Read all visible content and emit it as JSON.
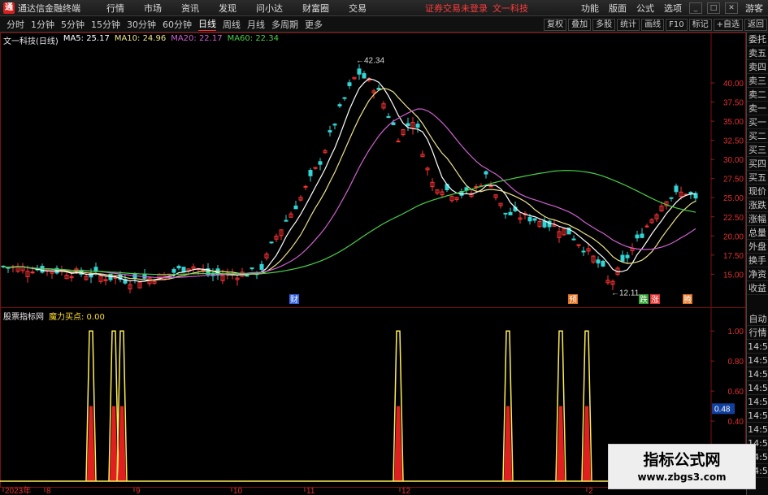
{
  "menubar": {
    "app_title": "通达信金融终端",
    "items": [
      "行情",
      "市场",
      "资讯",
      "发现",
      "问小达",
      "财富圈",
      "交易"
    ],
    "login_warning": "证券交易未登录",
    "stock_name": "文一科技",
    "right_items": [
      "功能",
      "版面",
      "公式",
      "选项"
    ],
    "guest": "游客"
  },
  "toolbar": {
    "periods": [
      "分时",
      "1分钟",
      "5分钟",
      "15分钟",
      "30分钟",
      "60分钟",
      "日线",
      "周线",
      "月线",
      "多周期",
      "更多"
    ],
    "active_period": "日线",
    "right_buttons": [
      "复权",
      "叠加",
      "多股",
      "统计",
      "画线",
      "F10",
      "标记",
      "+自选",
      "返回"
    ]
  },
  "main_panel": {
    "title": "文一科技(日线)",
    "ma5": "MA5: 25.17",
    "ma10": "MA10: 24.96",
    "ma20": "MA20: 22.17",
    "ma60": "MA60: 22.34",
    "high_label": "42.34",
    "low_label": "12.11",
    "markers": [
      "财",
      "预",
      "跌",
      "涨",
      "腾"
    ]
  },
  "sub_panel": {
    "title": "股票指标网",
    "indicator": "魔力买点: 0.00",
    "current_value": "0.48"
  },
  "side_panel": {
    "items": [
      "委托",
      "卖五",
      "卖四",
      "卖三",
      "卖二",
      "卖一",
      "买一",
      "买二",
      "买三",
      "买四",
      "买五",
      "现价",
      "涨跌",
      "涨幅",
      "总量",
      "外盘",
      "换手",
      "净资",
      "收益"
    ],
    "sub_items": [
      "自动",
      "行情",
      "14:5",
      "14:5",
      "14:5",
      "14:5",
      "14:5",
      "14:5",
      "14:5",
      "14:5",
      "14:5",
      "14:5"
    ]
  },
  "x_axis_labels": [
    "2023年",
    "8",
    "9",
    "10",
    "11",
    "12",
    "2"
  ],
  "watermark": {
    "title": "指标公式网",
    "url": "www.zbgs3.com"
  },
  "chart_data": [
    {
      "type": "line",
      "title": "文一科技(日线)",
      "y_ticks": [
        "40.00",
        "37.50",
        "35.00",
        "32.50",
        "30.00",
        "27.50",
        "25.00",
        "22.50",
        "20.00",
        "17.50",
        "15.00"
      ],
      "ylim": [
        11,
        45
      ],
      "series": [
        {
          "name": "MA5",
          "color": "#ffffff"
        },
        {
          "name": "MA10",
          "color": "#f0e38a"
        },
        {
          "name": "MA20",
          "color": "#d060d0"
        },
        {
          "name": "MA60",
          "color": "#48d048"
        }
      ],
      "colors": {
        "up": "#ff3333",
        "down": "#33d6d6"
      }
    },
    {
      "type": "line",
      "title": "魔力买点",
      "y_ticks": [
        "1.00",
        "0.80",
        "0.60",
        "0.40",
        "0.20"
      ],
      "ylim": [
        0,
        1.05
      ],
      "spike_dates_index": [
        112,
        140,
        150,
        490,
        625,
        690,
        722
      ],
      "colors": {
        "spike": "#ffee55",
        "fill": "#e02020"
      }
    }
  ]
}
